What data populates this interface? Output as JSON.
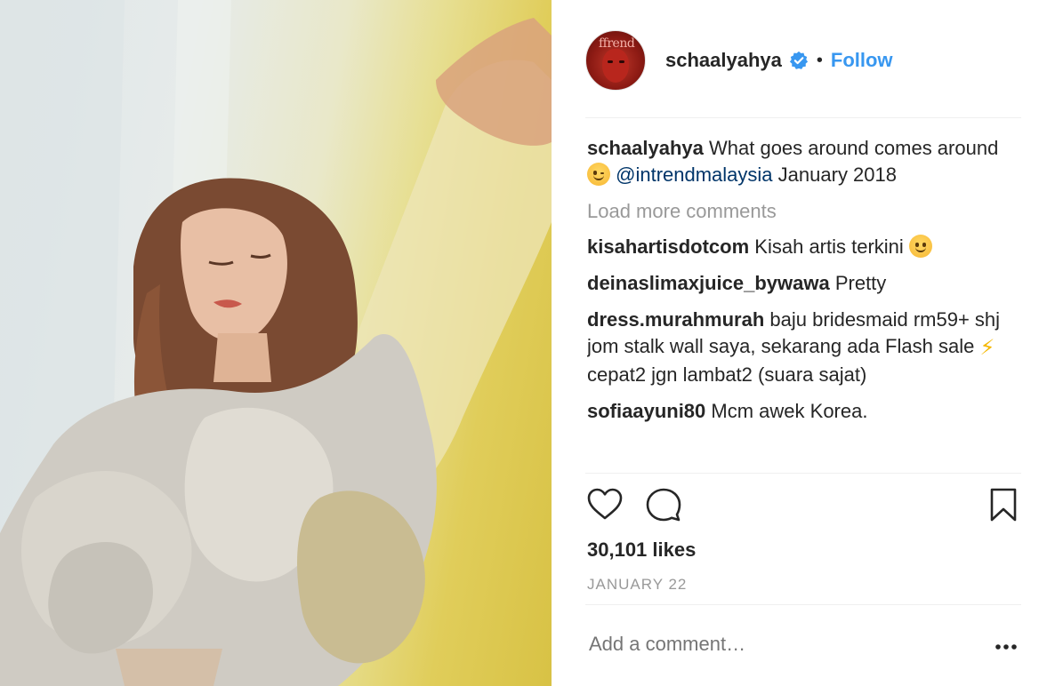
{
  "post": {
    "username": "schaalyahya",
    "separator": "•",
    "follow_label": "Follow",
    "avatar_text": "ffrend",
    "caption": {
      "username": "schaalyahya",
      "text_before": "What goes around comes around",
      "mention": "@intrendmalaysia",
      "text_after": "January 2018"
    },
    "load_more_label": "Load more comments",
    "comments": [
      {
        "username": "kisahartisdotcom",
        "text": "Kisah artis terkini"
      },
      {
        "username": "deinaslimaxjuice_bywawa",
        "text": "Pretty"
      },
      {
        "username": "dress.murahmurah",
        "text_before": "baju bridesmaid rm59+ shj jom stalk wall saya, sekarang ada Flash sale",
        "text_after": "cepat2 jgn lambat2 (suara sajat)"
      },
      {
        "username": "sofiaayuni80",
        "text": "Mcm awek Korea."
      }
    ],
    "likes": "30,101 likes",
    "date": "JANUARY 22",
    "add_comment_placeholder": "Add a comment…"
  },
  "icons": {
    "verified": "verified-badge-icon",
    "like": "heart-icon",
    "comment": "comment-bubble-icon",
    "save": "bookmark-icon",
    "more": "more-options-icon"
  },
  "colors": {
    "follow": "#3897f0",
    "mention": "#003569",
    "muted": "#999999",
    "text": "#262626"
  }
}
